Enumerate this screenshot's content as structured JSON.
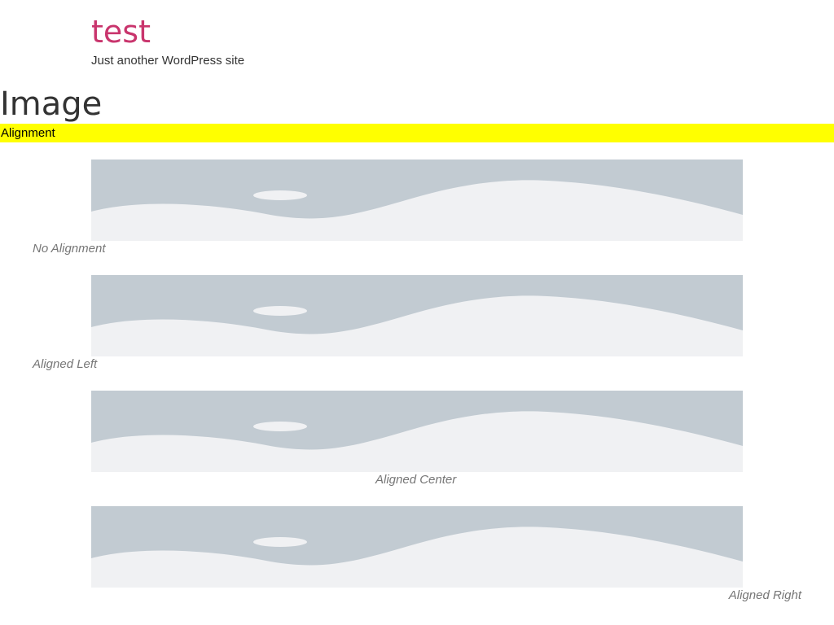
{
  "site": {
    "title": "test",
    "tagline": "Just another WordPress site"
  },
  "page": {
    "title": "Image",
    "section_heading": "Alignment"
  },
  "colors": {
    "title": "#c9356d",
    "highlight": "#ffff00",
    "placeholder_sky": "#c2cbd2",
    "placeholder_ground": "#f0f1f3",
    "caption": "#767676"
  },
  "figures": [
    {
      "caption": "No Alignment",
      "icon": "image-placeholder-icon"
    },
    {
      "caption": "Aligned Left",
      "icon": "image-placeholder-icon"
    },
    {
      "caption": "Aligned Center",
      "icon": "image-placeholder-icon"
    },
    {
      "caption": "Aligned Right",
      "icon": "image-placeholder-icon"
    }
  ]
}
